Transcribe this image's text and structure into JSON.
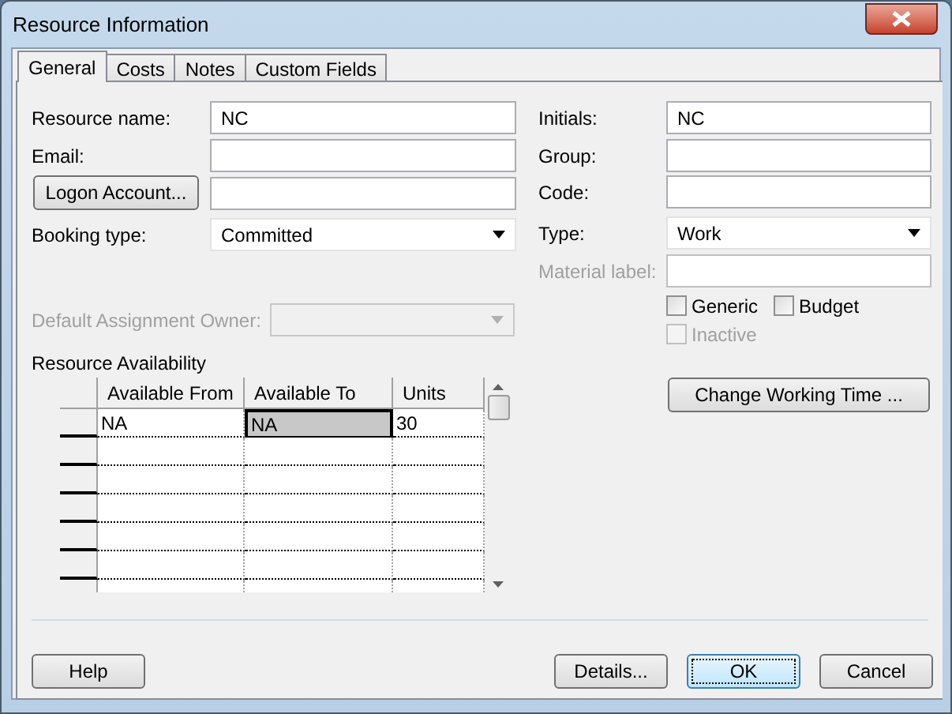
{
  "window": {
    "title": "Resource Information"
  },
  "tabs": [
    {
      "label": "General",
      "selected": true
    },
    {
      "label": "Costs",
      "selected": false
    },
    {
      "label": "Notes",
      "selected": false
    },
    {
      "label": "Custom Fields",
      "selected": false
    }
  ],
  "left_fields": [
    {
      "kind": "text",
      "label": "Resource name:",
      "value": "NC"
    },
    {
      "kind": "text",
      "label": "Email:"
    },
    {
      "kind": "button",
      "label": "Logon Account..."
    },
    {
      "kind": "dropdown",
      "label": "Booking type:",
      "value": "Committed"
    }
  ],
  "default_assignment_owner": {
    "label": "Default Assignment Owner:",
    "disabled": true
  },
  "right_fields": [
    {
      "kind": "text",
      "label": "Initials:",
      "value": "NC",
      "disabled": false
    },
    {
      "kind": "text",
      "label": "Group:",
      "disabled": false
    },
    {
      "kind": "text",
      "label": "Code:",
      "disabled": false
    },
    {
      "kind": "dropdown",
      "label": "Type:",
      "value": "Work",
      "disabled": false
    },
    {
      "kind": "text",
      "label": "Material label:",
      "disabled": true
    }
  ],
  "checkboxes": [
    {
      "label": "Generic",
      "checked": false,
      "disabled": false
    },
    {
      "label": "Budget",
      "checked": false,
      "disabled": false
    },
    {
      "label": "Inactive",
      "checked": false,
      "disabled": true
    }
  ],
  "availability": {
    "title": "Resource Availability",
    "columns": [
      "Available From",
      "Available To",
      "Units"
    ],
    "rows": [
      {
        "cells": [
          {
            "text": "NA",
            "selected": false
          },
          {
            "text": "NA",
            "selected": true
          },
          {
            "text": "30",
            "selected": false
          }
        ]
      }
    ]
  },
  "change_working_time": "Change Working Time ...",
  "buttons": [
    {
      "label": "Help",
      "default": false
    },
    {
      "label": "Details...",
      "default": false
    },
    {
      "label": "OK",
      "default": true
    },
    {
      "label": "Cancel",
      "default": false
    }
  ]
}
